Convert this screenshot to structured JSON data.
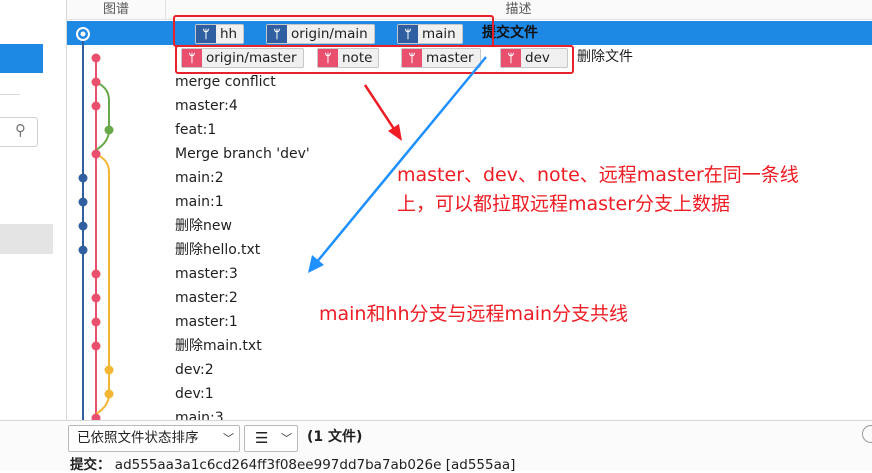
{
  "header": {
    "graph_col": "图谱",
    "desc_col": "描述"
  },
  "selected_row": {
    "tags": [
      {
        "label": "hh",
        "color": "#2f5fa0"
      },
      {
        "label": "origin/main",
        "color": "#2f5fa0"
      },
      {
        "label": "main",
        "color": "#2f5fa0"
      }
    ],
    "message": "提交文件"
  },
  "second_row": {
    "tags": [
      {
        "label": "origin/master",
        "color": "#e8506e"
      },
      {
        "label": "note",
        "color": "#e8506e"
      },
      {
        "label": "master",
        "color": "#e8506e"
      },
      {
        "label": "dev",
        "color": "#e8506e"
      }
    ],
    "message": "删除文件"
  },
  "commits": [
    "merge conflict",
    "master:4",
    "feat:1",
    "Merge branch 'dev'",
    "main:2",
    "main:1",
    "删除new",
    "删除hello.txt",
    "master:3",
    "master:2",
    "master:1",
    "删除main.txt",
    "dev:2",
    "dev:1",
    "main:3"
  ],
  "annotations": {
    "line1": "master、dev、note、远程master在同一条线",
    "line2": "上，可以都拉取远程master分支上数据",
    "line3": "main和hh分支与远程main分支共线",
    "color": "#ee1c24"
  },
  "bottom": {
    "sort_label": "已依照文件状态排序",
    "view_icon": "list-icon",
    "file_count": "(1 文件)",
    "commit_label": "提交：",
    "commit_hash": "ad555aa3a1c6cd264ff3f08ee997dd7ba7ab026e [ad555aa]"
  },
  "colors": {
    "selected": "#1e88e5",
    "branch_blue": "#2f5fa0",
    "branch_red": "#e8506e",
    "branch_green": "#67a84a",
    "branch_yellow": "#f2b632"
  }
}
